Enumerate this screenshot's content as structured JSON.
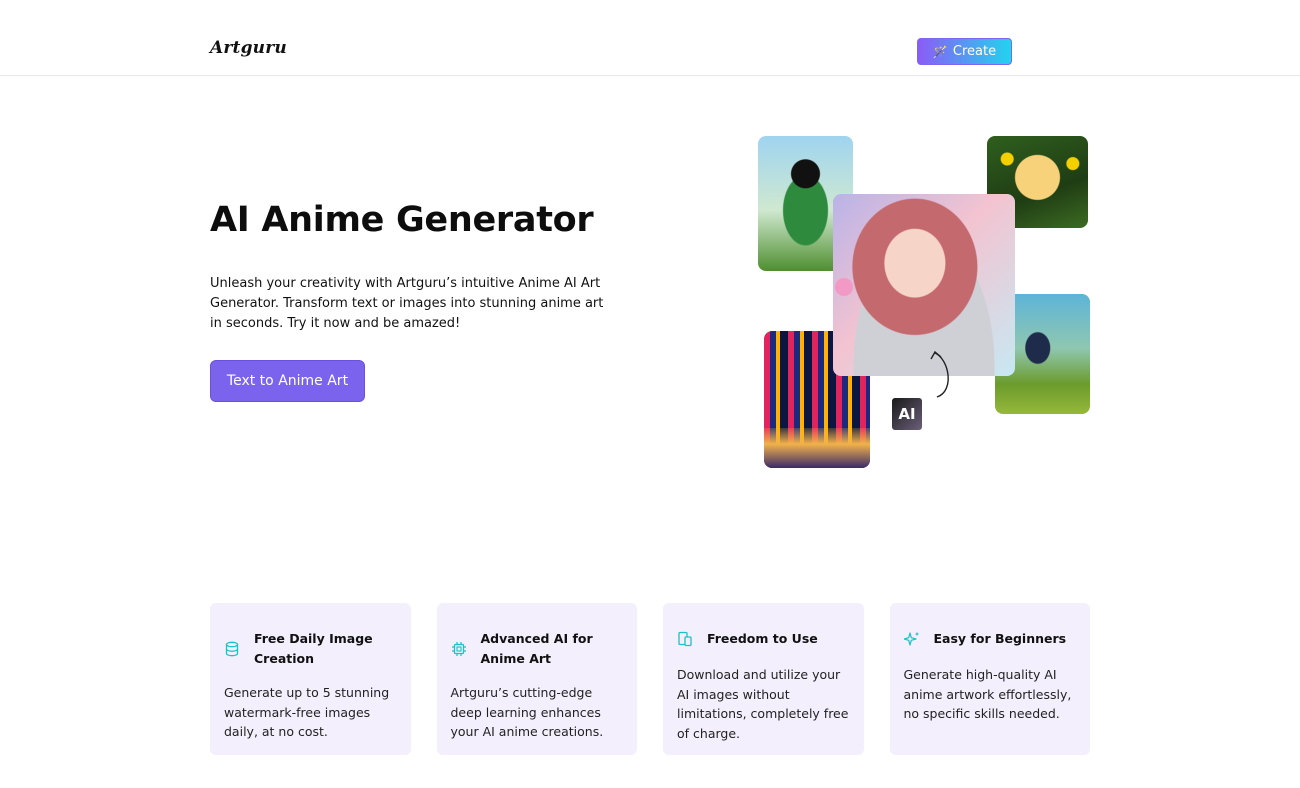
{
  "header": {
    "logo": "Artguru",
    "create_label": "Create",
    "create_icon": "magic-wand-icon"
  },
  "hero": {
    "title": "AI Anime Generator",
    "description": "Unleash your creativity with Artguru’s intuitive Anime AI Art Generator. Transform text or images into stunning anime art in seconds. Try it now and be amazed!",
    "cta_label": "Text to Anime Art",
    "ai_badge": "AI"
  },
  "features": [
    {
      "icon": "database-icon",
      "title": "Free Daily Image Creation",
      "text": "Generate up to 5 stunning watermark-free images daily, at no cost."
    },
    {
      "icon": "chip-icon",
      "title": "Advanced AI for Anime Art",
      "text": "Artguru’s cutting-edge deep learning enhances your AI anime creations."
    },
    {
      "icon": "devices-icon",
      "title": "Freedom to Use",
      "text": "Download and utilize your AI images without limitations, completely free of charge."
    },
    {
      "icon": "sparkles-icon",
      "title": "Easy for Beginners",
      "text": "Generate high-quality AI anime artwork effortlessly, no specific skills needed."
    }
  ],
  "colors": {
    "accent": "#7c63ee",
    "icon_teal": "#19c3c7",
    "card_bg": "#f3effd"
  }
}
